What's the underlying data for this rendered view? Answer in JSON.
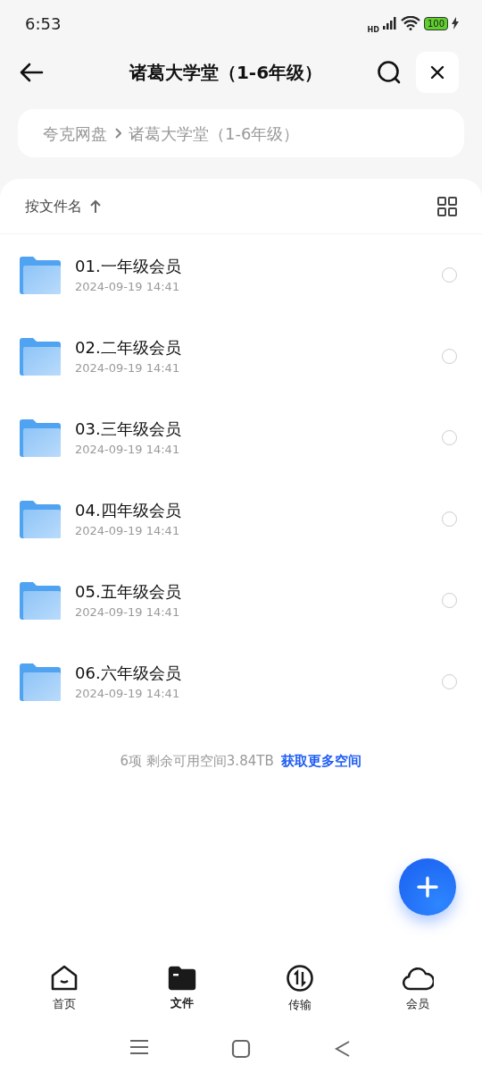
{
  "status_bar": {
    "time": "6:53",
    "network": "HD",
    "battery": "100"
  },
  "header": {
    "title": "诸葛大学堂（1-6年级）"
  },
  "breadcrumb": [
    {
      "label": "夸克网盘"
    },
    {
      "label": "诸葛大学堂（1-6年级）"
    }
  ],
  "sort": {
    "label": "按文件名"
  },
  "files": [
    {
      "name": "01.一年级会员",
      "date": "2024-09-19 14:41",
      "selected": false
    },
    {
      "name": "02.二年级会员",
      "date": "2024-09-19 14:41",
      "selected": false
    },
    {
      "name": "03.三年级会员",
      "date": "2024-09-19 14:41",
      "selected": false
    },
    {
      "name": "04.四年级会员",
      "date": "2024-09-19 14:41",
      "selected": false
    },
    {
      "name": "05.五年级会员",
      "date": "2024-09-19 14:41",
      "selected": false
    },
    {
      "name": "06.六年级会员",
      "date": "2024-09-19 14:41",
      "selected": false
    }
  ],
  "footer": {
    "summary": "6项 剩余可用空间3.84TB",
    "link": "获取更多空间"
  },
  "tabs": [
    {
      "label": "首页",
      "kind": "home",
      "selected": false
    },
    {
      "label": "文件",
      "kind": "files",
      "selected": true
    },
    {
      "label": "传输",
      "kind": "transfer",
      "selected": false
    },
    {
      "label": "会员",
      "kind": "member",
      "selected": false
    }
  ]
}
